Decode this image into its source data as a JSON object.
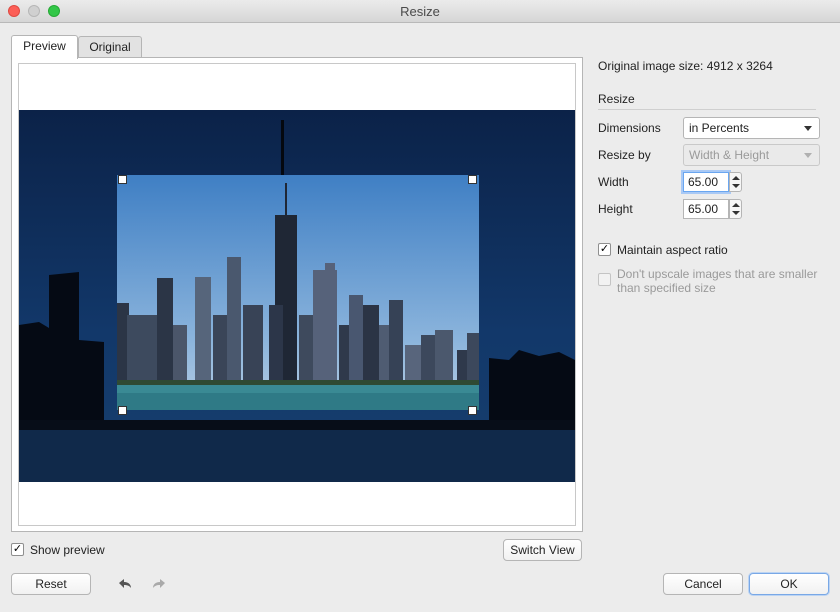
{
  "window": {
    "title": "Resize"
  },
  "tabs": [
    {
      "label": "Preview"
    },
    {
      "label": "Original"
    }
  ],
  "info": {
    "original_size": "Original image size: 4912 x 3264"
  },
  "resize_section": {
    "heading": "Resize"
  },
  "dimensions": {
    "label": "Dimensions",
    "value": "in Percents"
  },
  "resize_by": {
    "label": "Resize by",
    "value": "Width & Height"
  },
  "width": {
    "label": "Width",
    "value": "65.00"
  },
  "height": {
    "label": "Height",
    "value": "65.00"
  },
  "maintain_aspect": {
    "label": "Maintain aspect ratio",
    "checked": true
  },
  "no_upscale": {
    "label_line1": "Don't upscale images that are smaller",
    "label_line2": "than specified size",
    "checked": false
  },
  "show_preview": {
    "label": "Show preview",
    "checked": true
  },
  "buttons": {
    "switch_view": "Switch View",
    "reset": "Reset",
    "cancel": "Cancel",
    "ok": "OK"
  },
  "colors": {
    "accent": "#6aa6f0",
    "sky_dim": "#0f2c55",
    "sky_bright": "#4a86c8"
  }
}
